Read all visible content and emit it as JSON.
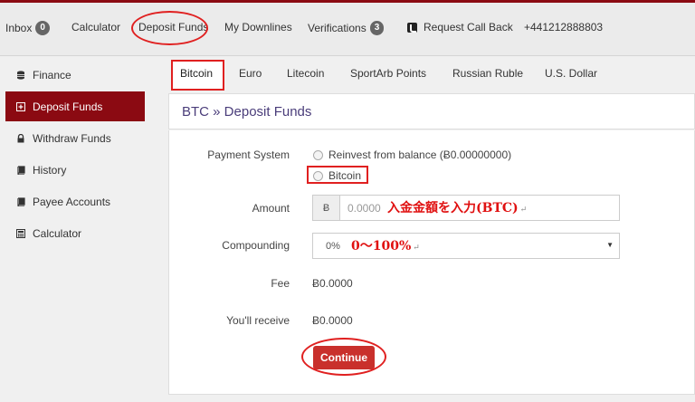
{
  "topnav": {
    "inbox": {
      "label": "Inbox",
      "count": "0"
    },
    "calculator": "Calculator",
    "deposit_funds": "Deposit Funds",
    "my_downlines": "My Downlines",
    "verifications": {
      "label": "Verifications",
      "count": "3"
    },
    "request_call_back": "Request Call Back",
    "phone": "+441212888803"
  },
  "sidebar": {
    "items": [
      {
        "label": "Finance",
        "icon": "database-icon"
      },
      {
        "label": "Deposit Funds",
        "icon": "plus-square-icon",
        "active": true
      },
      {
        "label": "Withdraw Funds",
        "icon": "lock-icon"
      },
      {
        "label": "History",
        "icon": "book-icon"
      },
      {
        "label": "Payee Accounts",
        "icon": "book-icon"
      },
      {
        "label": "Calculator",
        "icon": "calculator-icon"
      }
    ]
  },
  "tabs": [
    "Bitcoin",
    "Euro",
    "Litecoin",
    "SportArb Points",
    "Russian Ruble",
    "U.S. Dollar"
  ],
  "card": {
    "title": "BTC » Deposit Funds"
  },
  "form": {
    "payment_system_label": "Payment System",
    "radio_reinvest": "Reinvest from balance (Ƀ0.00000000)",
    "radio_bitcoin": "Bitcoin",
    "amount_label": "Amount",
    "amount_addon": "Ƀ",
    "amount_placeholder": "0.0000",
    "amount_note": "入金金額を入力(BTC)",
    "compounding_label": "Compounding",
    "compounding_value": "0%",
    "compounding_note": "0～100%",
    "fee_label": "Fee",
    "fee_value": "Ƀ0.0000",
    "receive_label": "You'll receive",
    "receive_value": "Ƀ0.0000",
    "continue_label": "Continue",
    "return_mark": "↵"
  },
  "colors": {
    "brand": "#8b0a12",
    "button": "#c9302c",
    "annotation": "#e02020",
    "title": "#4a3d7a"
  }
}
